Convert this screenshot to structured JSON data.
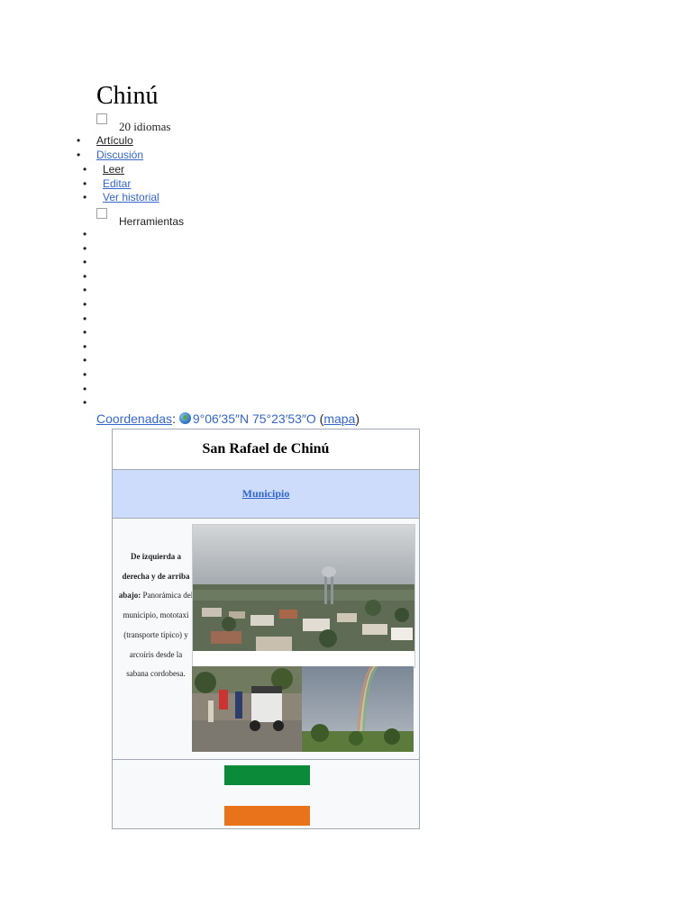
{
  "page": {
    "title": "Chinú",
    "languages_label": "20 idiomas"
  },
  "namespaces": [
    {
      "label": "Artículo",
      "is_link": false
    },
    {
      "label": "Discusión",
      "is_link": true
    }
  ],
  "views": [
    {
      "label": "Leer",
      "is_link": false
    },
    {
      "label": "Editar",
      "is_link": true
    },
    {
      "label": "Ver historial",
      "is_link": true
    }
  ],
  "tools_label": "Herramientas",
  "empty_bullets_count": 13,
  "coordinates": {
    "label": "Coordenadas",
    "separator": ":",
    "value": "9°06′35″N 75°23′53″O",
    "open_paren": "(",
    "map_link": "mapa",
    "close_paren": ")",
    "icon": "globe-icon"
  },
  "infobox": {
    "title": "San Rafael de Chinú",
    "subtitle": "Municipio",
    "caption_bold": "De izquierda a derecha y de arriba abajo:",
    "caption_text": " Panorámica del municipio, mototaxi (transporte típico) y arcoíris desde la sabana cordobesa.",
    "images": [
      "panoramic-town-image",
      "mototaxi-image",
      "rainbow-savanna-image"
    ],
    "flag_colors": {
      "green": "#0b8b3a",
      "orange": "#e8731a"
    }
  },
  "colors": {
    "link": "#3366cc",
    "infobox_header": "#cddcfa",
    "border": "#a2a9b1"
  }
}
